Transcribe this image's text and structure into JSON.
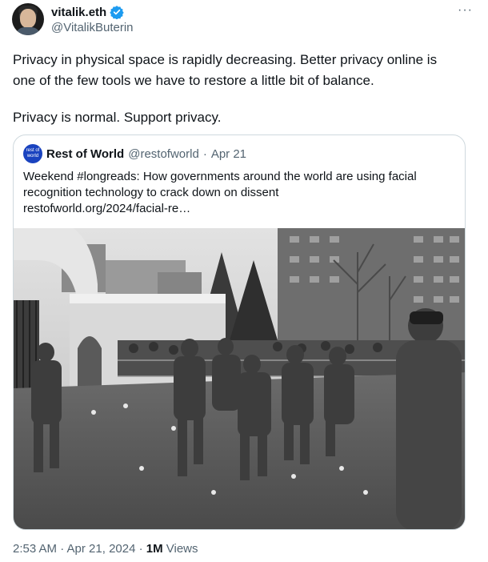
{
  "author": {
    "name": "vitalik.eth",
    "handle": "@VitalikButerin",
    "verified": true,
    "verified_color": "#1d9bf0"
  },
  "more_label": "···",
  "tweet": {
    "paragraphs": [
      "Privacy in physical space is rapidly decreasing. Better privacy online is one of the few tools we have to restore a little bit of balance.",
      "Privacy is normal. Support privacy."
    ]
  },
  "quote": {
    "logo_text": "rest of world",
    "name": "Rest of World",
    "handle": "@restofworld",
    "separator": "·",
    "date": "Apr 21",
    "line1": "Weekend #longreads: How governments around the world are using facial",
    "line2": "recognition technology to crack down on dissent",
    "link": "restofworld.org/2024/facial-re…"
  },
  "footer": {
    "time": "2:53 AM · Apr 21, 2024 · ",
    "views_count": "1M",
    "views_label": " Views"
  }
}
